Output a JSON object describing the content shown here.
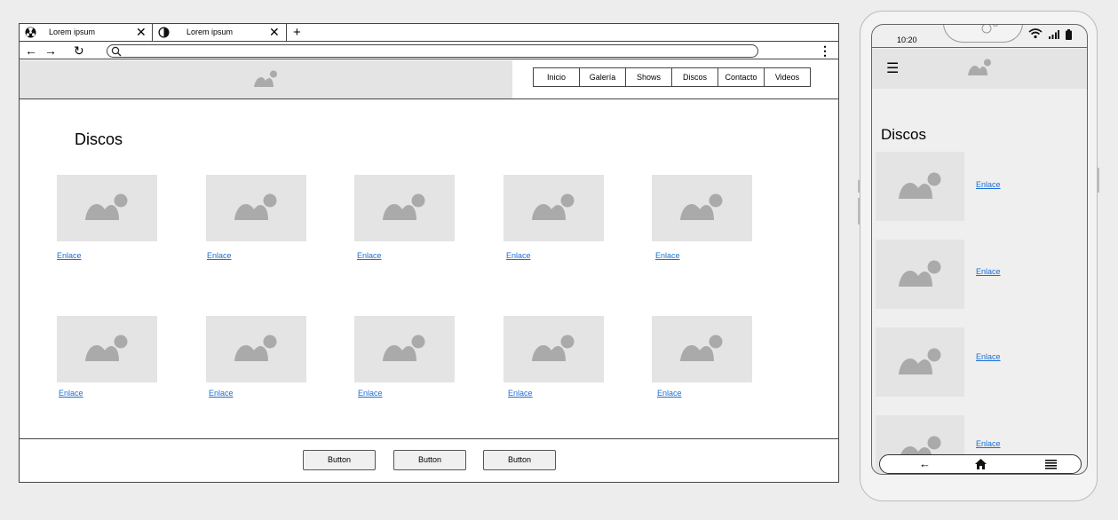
{
  "browser": {
    "tabs": [
      {
        "label": "Lorem ipsum",
        "icon": "radiation-icon"
      },
      {
        "label": "Lorem ipsum",
        "icon": "contrast-icon"
      }
    ],
    "new_tab": "+",
    "close_glyph": "✕"
  },
  "site": {
    "nav": [
      "Inicio",
      "Galería",
      "Shows",
      "Discos",
      "Contacto",
      "Videos"
    ],
    "heading": "Discos",
    "row1_links": [
      "Enlace",
      "Enlace",
      "Enlace",
      "Enlace",
      "Enlace"
    ],
    "row2_links": [
      "Enlace",
      "Enlace",
      "Enlace",
      "Enlace",
      "Enlace"
    ],
    "footer_buttons": [
      "Button",
      "Button",
      "Button"
    ]
  },
  "mobile": {
    "time": "10:20",
    "heading": "Discos",
    "links": [
      "Enlace",
      "Enlace",
      "Enlace",
      "Enlace"
    ]
  },
  "colors": {
    "link": "#1a6fd6",
    "placeholder": "#e4e4e4",
    "placeholder_icon": "#aaaaaa"
  }
}
